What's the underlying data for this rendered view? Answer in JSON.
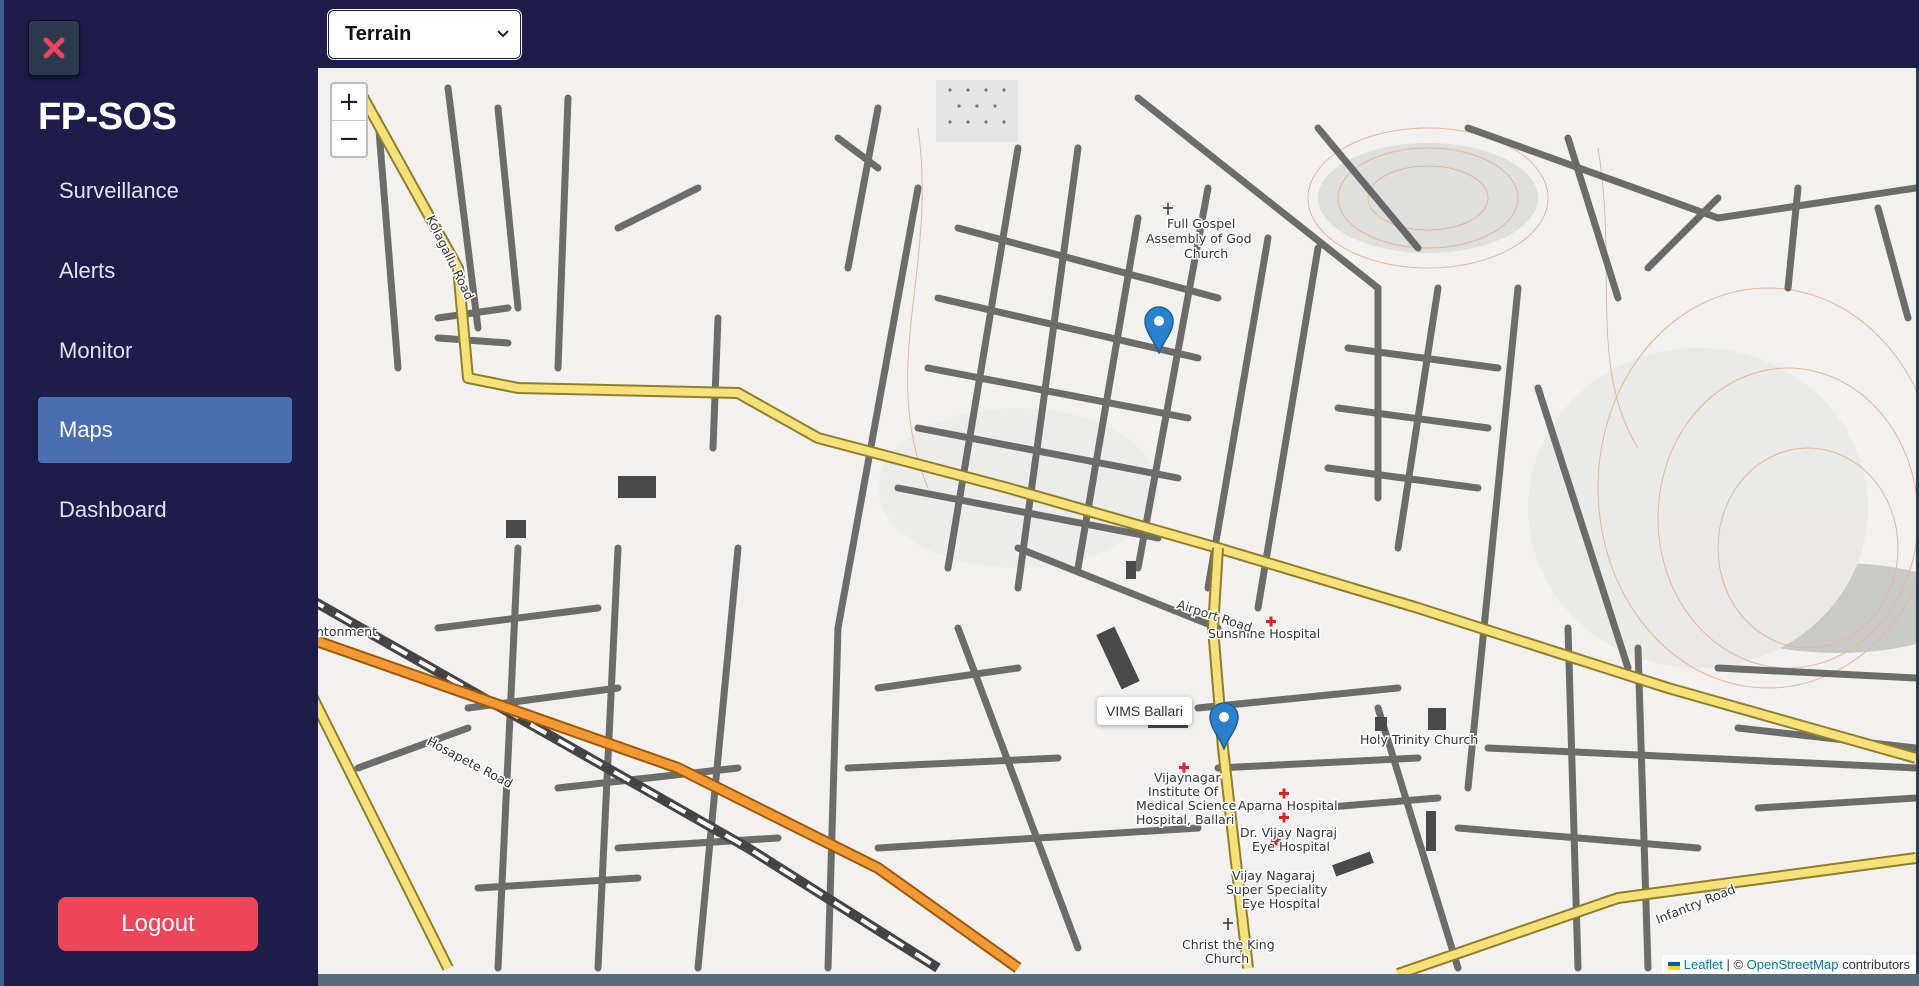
{
  "sidebar": {
    "close_icon": "close-x-icon",
    "brand": "FP-SOS",
    "items": [
      {
        "label": "Surveillance",
        "active": false
      },
      {
        "label": "Alerts",
        "active": false
      },
      {
        "label": "Monitor",
        "active": false
      },
      {
        "label": "Maps",
        "active": true
      },
      {
        "label": "Dashboard",
        "active": false
      }
    ],
    "logout_label": "Logout"
  },
  "topbar": {
    "layer_select": {
      "selected": "Terrain"
    }
  },
  "map": {
    "zoom_in": "+",
    "zoom_out": "−",
    "popup": "VIMS Ballari",
    "labels": {
      "church1_l1": "Full Gospel",
      "church1_l2": "Assembly of God",
      "church1_l3": "Church",
      "koragallu": "Kolagallu Road",
      "airport": "Airport Road",
      "sunshine": "Sunshine Hospital",
      "holy_trinity": "Holy Trinity Church",
      "vims_l1": "Vijaynagar",
      "vims_l2": "Institute Of",
      "vims_l3": "Medical Science",
      "vims_l4": "Hospital, Ballari",
      "aparna": "Aparna Hospital",
      "drvijay_l1": "Dr. Vijay Nagraj",
      "drvijay_l2": "Eye Hospital",
      "vijaysuper_l1": "Vijay Nagaraj",
      "vijaysuper_l2": "Super Speciality",
      "vijaysuper_l3": "Eye Hospital",
      "christ_l1": "Christ the King",
      "christ_l2": "Church",
      "hospete": "Hosapete Road",
      "infantry": "Infantry Road",
      "cantonment": "ntonment"
    },
    "attribution": {
      "leaflet": "Leaflet",
      "sep": "| ©",
      "osm": "OpenStreetMap",
      "contributors": "contributors"
    }
  },
  "colors": {
    "sidebar_bg": "#1d1c4a",
    "active_bg": "#4a6fb0",
    "logout_bg": "#f0465a",
    "marker": "#2a81cb",
    "major_road": "#f7e27a"
  }
}
